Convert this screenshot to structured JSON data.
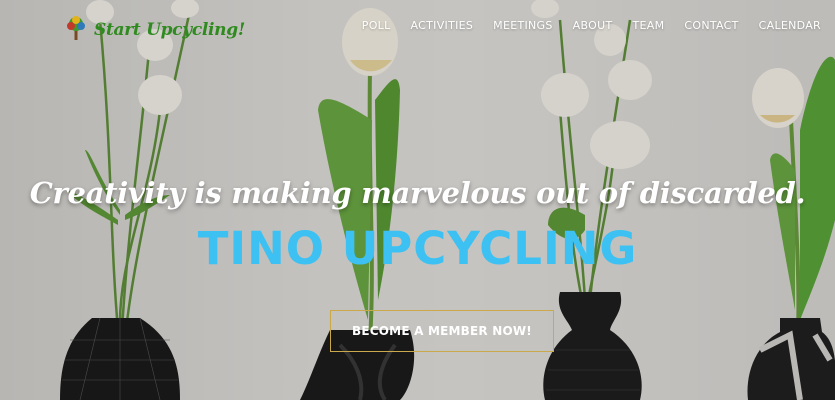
{
  "brand": {
    "name": "Start Upcycling!",
    "logo_icon": "tree-logo-icon",
    "color": "#2f8a1f"
  },
  "nav": {
    "items": [
      {
        "label": "POLL"
      },
      {
        "label": "ACTIVITIES"
      },
      {
        "label": "MEETINGS"
      },
      {
        "label": "ABOUT"
      },
      {
        "label": "TEAM"
      },
      {
        "label": "CONTACT"
      },
      {
        "label": "CALENDAR"
      }
    ]
  },
  "hero": {
    "tagline": "Creativity is making marvelous out of discarded.",
    "title": "TINO UPCYCLING",
    "title_color": "#3cc1f2",
    "cta_label": "BECOME A MEMBER NOW!",
    "cta_border_color": "#c9a94a"
  }
}
